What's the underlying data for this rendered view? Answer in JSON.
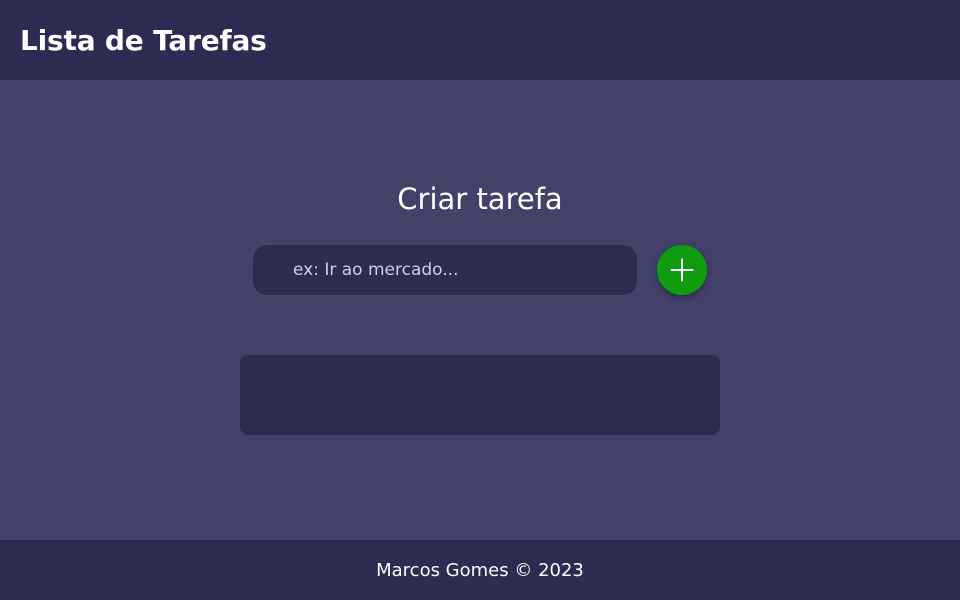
{
  "header": {
    "title": "Lista de Tarefas"
  },
  "main": {
    "section_title": "Criar tarefa",
    "input": {
      "placeholder": "ex: Ir ao mercado...",
      "value": ""
    },
    "add_button": {
      "icon": "plus-icon",
      "color": "#0f9d0f"
    },
    "task_list": {
      "items": []
    }
  },
  "footer": {
    "text": "Marcos Gomes © 2023"
  },
  "colors": {
    "background": "#43416a",
    "panel": "#2d2b52",
    "accent": "#0f9d0f",
    "text": "#ffffff"
  }
}
